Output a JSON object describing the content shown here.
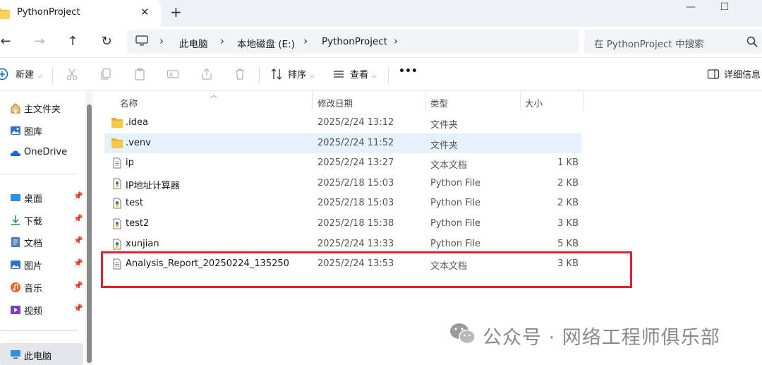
{
  "window": {
    "tab_title": "PythonProject",
    "close_tab": "✕",
    "new_tab": "+",
    "minimize": "—",
    "maximize": "☐"
  },
  "nav": {
    "back": "←",
    "forward": "→",
    "up": "↑",
    "refresh": "↻",
    "breadcrumb": [
      "此电脑",
      "本地磁盘 (E:)",
      "PythonProject"
    ],
    "search_placeholder": "在 PythonProject 中搜索"
  },
  "toolbar": {
    "new_label": "新建",
    "sort_label": "排序",
    "view_label": "查看",
    "more": "•••",
    "details_label": "详细信息"
  },
  "sidebar": {
    "top_items": [
      "主文件夹",
      "图库",
      "OneDrive"
    ],
    "pinned_items": [
      "桌面",
      "下载",
      "文档",
      "图片",
      "音乐",
      "视频"
    ],
    "bottom_item": "此电脑"
  },
  "columns": {
    "name": "名称",
    "date": "修改日期",
    "type": "类型",
    "size": "大小"
  },
  "files": [
    {
      "name": ".idea",
      "date": "2025/2/24 13:12",
      "type": "文件夹",
      "size": "",
      "icon": "folder-icon"
    },
    {
      "name": ".venv",
      "date": "2025/2/24 11:52",
      "type": "文件夹",
      "size": "",
      "icon": "folder-icon"
    },
    {
      "name": "ip",
      "date": "2025/2/24 13:27",
      "type": "文本文档",
      "size": "1 KB",
      "icon": "text-file-icon"
    },
    {
      "name": "IP地址计算器",
      "date": "2025/2/18 15:03",
      "type": "Python File",
      "size": "2 KB",
      "icon": "python-file-icon"
    },
    {
      "name": "test",
      "date": "2025/2/18 15:03",
      "type": "Python File",
      "size": "2 KB",
      "icon": "python-file-icon"
    },
    {
      "name": "test2",
      "date": "2025/2/18 15:38",
      "type": "Python File",
      "size": "3 KB",
      "icon": "python-file-icon"
    },
    {
      "name": "xunjian",
      "date": "2025/2/24 13:33",
      "type": "Python File",
      "size": "5 KB",
      "icon": "python-file-icon"
    },
    {
      "name": "Analysis_Report_20250224_135250",
      "date": "2025/2/24 13:53",
      "type": "文本文档",
      "size": "3 KB",
      "icon": "text-file-icon"
    }
  ],
  "watermark": {
    "text": "公众号 · 网络工程师俱乐部"
  },
  "colors": {
    "accent": "#0067c0",
    "folder": "#f5c342",
    "highlight": "#e0202a",
    "selected_row": "#e5f1fb"
  }
}
